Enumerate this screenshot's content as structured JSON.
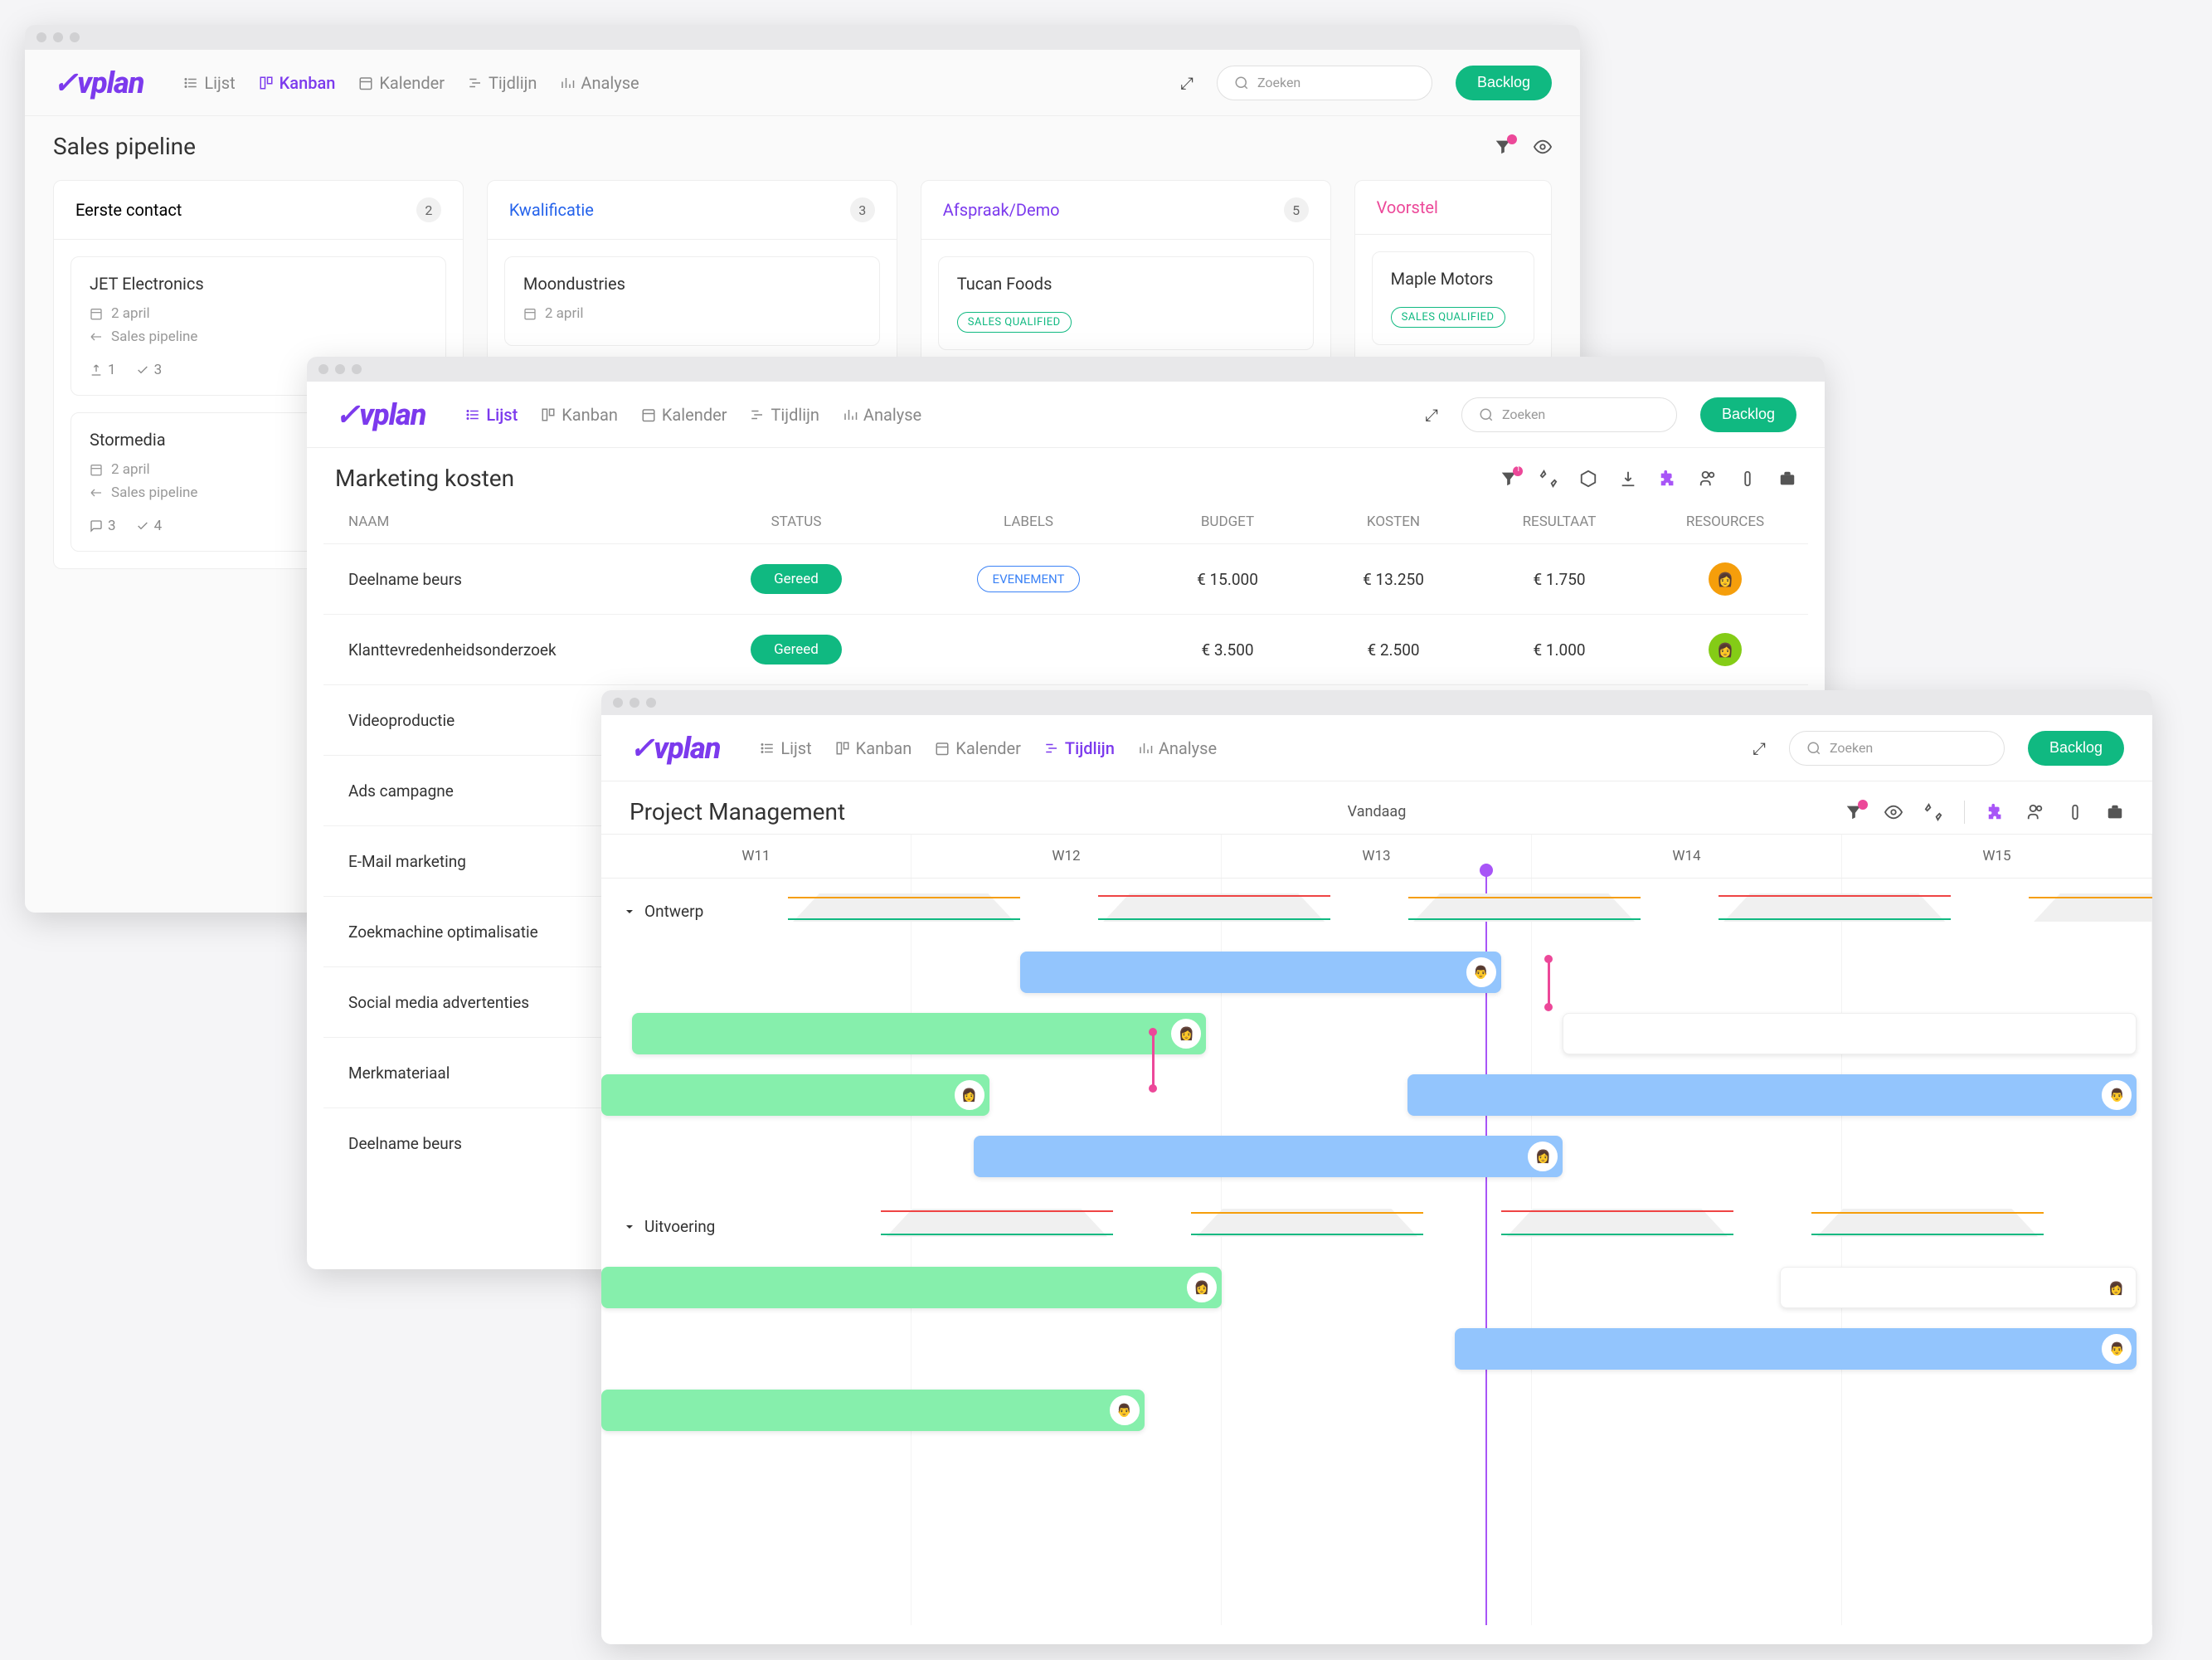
{
  "brand": "vplan",
  "nav": {
    "lijst": "Lijst",
    "kanban": "Kanban",
    "kalender": "Kalender",
    "tijdlijn": "Tijdlijn",
    "analyse": "Analyse"
  },
  "search_placeholder": "Zoeken",
  "backlog": "Backlog",
  "window1": {
    "title": "Sales pipeline",
    "columns": [
      {
        "name": "Eerste contact",
        "count": "2",
        "color": "#333"
      },
      {
        "name": "Kwalificatie",
        "count": "3",
        "color": "#2563eb"
      },
      {
        "name": "Afspraak/Demo",
        "count": "5",
        "color": "#7c3aed"
      },
      {
        "name": "Voorstel",
        "count": "",
        "color": "#ec4899"
      }
    ],
    "cards": {
      "c0": {
        "title": "JET Electronics",
        "date": "2 april",
        "pipeline": "Sales pipeline",
        "m1": "1",
        "m2": "3"
      },
      "c1": {
        "title": "Stormedia",
        "date": "2 april",
        "pipeline": "Sales pipeline",
        "m1": "3",
        "m2": "4"
      },
      "c2": {
        "title": "Moondustries",
        "date": "2 april"
      },
      "c3": {
        "title": "Tucan Foods",
        "badge": "SALES QUALIFIED"
      },
      "c4": {
        "title": "Maple Motors",
        "badge": "SALES QUALIFIED"
      }
    }
  },
  "window2": {
    "title": "Marketing kosten",
    "filter_count": "1",
    "headers": {
      "naam": "NAAM",
      "status": "STATUS",
      "labels": "LABELS",
      "budget": "BUDGET",
      "kosten": "KOSTEN",
      "resultaat": "RESULTAAT",
      "resources": "RESOURCES"
    },
    "rows": [
      {
        "naam": "Deelname beurs",
        "status": "Gereed",
        "label": "EVENEMENT",
        "budget": "€ 15.000",
        "kosten": "€ 13.250",
        "resultaat": "€ 1.750"
      },
      {
        "naam": "Klanttevredenheidsonderzoek",
        "status": "Gereed",
        "label": "",
        "budget": "€ 3.500",
        "kosten": "€ 2.500",
        "resultaat": "€ 1.000"
      },
      {
        "naam": "Videoproductie",
        "status": "",
        "label": "",
        "budget": "",
        "kosten": "",
        "resultaat": ""
      },
      {
        "naam": "Ads campagne",
        "status": "",
        "label": "",
        "budget": "",
        "kosten": "",
        "resultaat": ""
      },
      {
        "naam": "E-Mail marketing",
        "status": "",
        "label": "",
        "budget": "",
        "kosten": "",
        "resultaat": ""
      },
      {
        "naam": "Zoekmachine optimalisatie",
        "status": "",
        "label": "",
        "budget": "",
        "kosten": "",
        "resultaat": ""
      },
      {
        "naam": "Social media advertenties",
        "status": "",
        "label": "",
        "budget": "",
        "kosten": "",
        "resultaat": ""
      },
      {
        "naam": "Merkmateriaal",
        "status": "",
        "label": "",
        "budget": "",
        "kosten": "",
        "resultaat": ""
      },
      {
        "naam": "Deelname beurs",
        "status": "",
        "label": "",
        "budget": "",
        "kosten": "",
        "resultaat": ""
      }
    ]
  },
  "window3": {
    "title": "Project Management",
    "today": "Vandaag",
    "weeks": [
      "W11",
      "W12",
      "W13",
      "W14",
      "W15"
    ],
    "phases": {
      "ontwerp": "Ontwerp",
      "uitvoering": "Uitvoering"
    }
  }
}
